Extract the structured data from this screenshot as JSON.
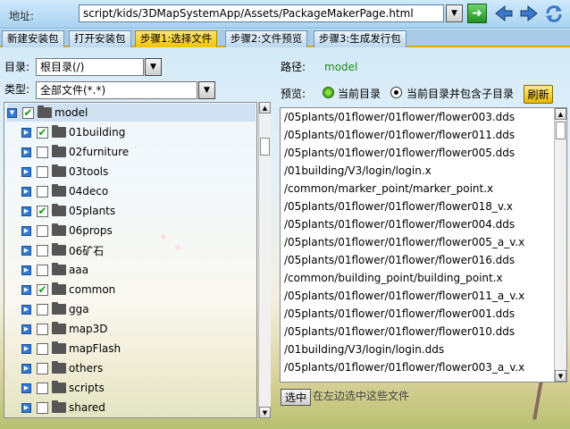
{
  "address": {
    "label": "地址:",
    "value": "script/kids/3DMapSystemApp/Assets/PackageMakerPage.html",
    "go_label": "➜"
  },
  "tabs": [
    {
      "label": "新建安装包",
      "active": false
    },
    {
      "label": "打开安装包",
      "active": false
    },
    {
      "label": "步骤1:选择文件",
      "active": true
    },
    {
      "label": "步骤2:文件预览",
      "active": false
    },
    {
      "label": "步骤3:生成发行包",
      "active": false
    }
  ],
  "left": {
    "dir_label": "目录:",
    "dir_value": "根目录(/)",
    "type_label": "类型:",
    "type_value": "全部文件(*.*)",
    "tree": [
      {
        "label": "model",
        "checked": true,
        "level": 0,
        "expanded": true,
        "selected": true
      },
      {
        "label": "01building",
        "checked": true,
        "level": 1
      },
      {
        "label": "02furniture",
        "checked": false,
        "level": 1
      },
      {
        "label": "03tools",
        "checked": false,
        "level": 1
      },
      {
        "label": "04deco",
        "checked": false,
        "level": 1
      },
      {
        "label": "05plants",
        "checked": true,
        "level": 1
      },
      {
        "label": "06props",
        "checked": false,
        "level": 1
      },
      {
        "label": "06矿石",
        "checked": false,
        "level": 1
      },
      {
        "label": "aaa",
        "checked": false,
        "level": 1
      },
      {
        "label": "common",
        "checked": true,
        "level": 1
      },
      {
        "label": "gga",
        "checked": false,
        "level": 1
      },
      {
        "label": "map3D",
        "checked": false,
        "level": 1
      },
      {
        "label": "mapFlash",
        "checked": false,
        "level": 1
      },
      {
        "label": "others",
        "checked": false,
        "level": 1
      },
      {
        "label": "scripts",
        "checked": false,
        "level": 1
      },
      {
        "label": "shared",
        "checked": false,
        "level": 1
      }
    ]
  },
  "right": {
    "path_label": "路径:",
    "path_value": "model",
    "preview_label": "预览:",
    "option_current": "当前目录",
    "option_with_sub": "当前目录并包含子目录",
    "refresh_label": "刷新",
    "files": [
      "/05plants/01flower/01flower/flower003.dds",
      "/05plants/01flower/01flower/flower011.dds",
      "/05plants/01flower/01flower/flower005.dds",
      "/01building/V3/login/login.x",
      "/common/marker_point/marker_point.x",
      "/05plants/01flower/01flower/flower018_v.x",
      "/05plants/01flower/01flower/flower004.dds",
      "/05plants/01flower/01flower/flower005_a_v.x",
      "/05plants/01flower/01flower/flower016.dds",
      "/common/building_point/building_point.x",
      "/05plants/01flower/01flower/flower011_a_v.x",
      "/05plants/01flower/01flower/flower001.dds",
      "/05plants/01flower/01flower/flower010.dds",
      "/01building/V3/login/login.dds",
      "/05plants/01flower/01flower/flower003_a_v.x"
    ],
    "select_label": "选中",
    "select_hint": "在左边选中这些文件"
  }
}
